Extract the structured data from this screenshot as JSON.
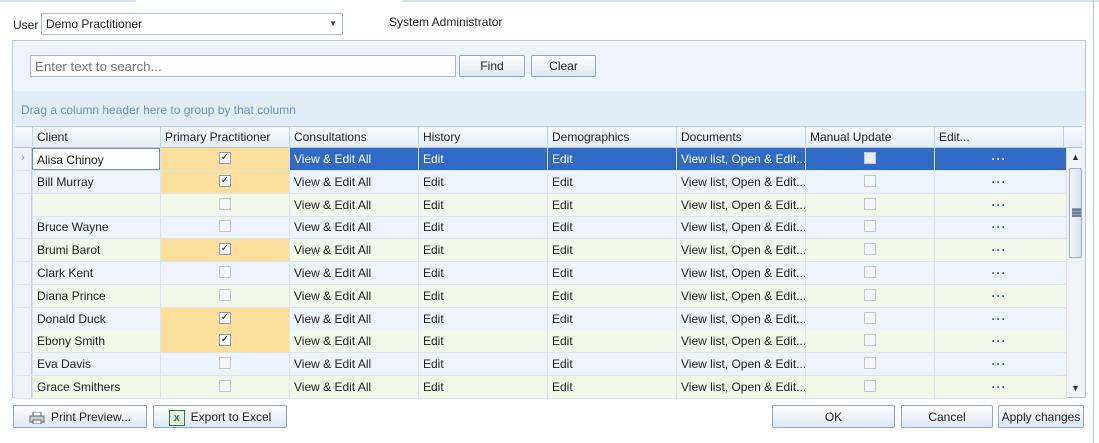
{
  "user": {
    "label": "User",
    "selected": "Demo Practitioner",
    "role": "System Administrator"
  },
  "search": {
    "placeholder": "Enter text to search...",
    "find_label": "Find",
    "clear_label": "Clear"
  },
  "group_hint": "Drag a column header here to group by that column",
  "columns": [
    "Client",
    "Primary Practitioner",
    "Consultations",
    "History",
    "Demographics",
    "Documents",
    "Manual Update",
    "Edit..."
  ],
  "rows": [
    {
      "client": "Alisa Chinoy",
      "primary": true,
      "consultations": "View & Edit All",
      "history": "Edit",
      "demographics": "Edit",
      "documents": "View list, Open & Edit...",
      "manual": false,
      "edit": "···",
      "selected": true
    },
    {
      "client": "Bill Murray",
      "primary": true,
      "consultations": "View & Edit All",
      "history": "Edit",
      "demographics": "Edit",
      "documents": "View list, Open & Edit...",
      "manual": false,
      "edit": "···"
    },
    {
      "client": "",
      "primary": false,
      "consultations": "View & Edit All",
      "history": "Edit",
      "demographics": "Edit",
      "documents": "View list, Open & Edit...",
      "manual": false,
      "edit": "···"
    },
    {
      "client": "Bruce Wayne",
      "primary": false,
      "consultations": "View & Edit All",
      "history": "Edit",
      "demographics": "Edit",
      "documents": "View list, Open & Edit...",
      "manual": false,
      "edit": "···"
    },
    {
      "client": "Brumi Barot",
      "primary": true,
      "consultations": "View & Edit All",
      "history": "Edit",
      "demographics": "Edit",
      "documents": "View list, Open & Edit...",
      "manual": false,
      "edit": "···"
    },
    {
      "client": "Clark Kent",
      "primary": false,
      "consultations": "View & Edit All",
      "history": "Edit",
      "demographics": "Edit",
      "documents": "View list, Open & Edit...",
      "manual": false,
      "edit": "···"
    },
    {
      "client": "Diana Prince",
      "primary": false,
      "consultations": "View & Edit All",
      "history": "Edit",
      "demographics": "Edit",
      "documents": "View list, Open & Edit...",
      "manual": false,
      "edit": "···"
    },
    {
      "client": "Donald Duck",
      "primary": true,
      "consultations": "View & Edit All",
      "history": "Edit",
      "demographics": "Edit",
      "documents": "View list, Open & Edit...",
      "manual": false,
      "edit": "···"
    },
    {
      "client": "Ebony Smith",
      "primary": true,
      "consultations": "View & Edit All",
      "history": "Edit",
      "demographics": "Edit",
      "documents": "View list, Open & Edit...",
      "manual": false,
      "edit": "···"
    },
    {
      "client": "Eva Davis",
      "primary": false,
      "consultations": "View & Edit All",
      "history": "Edit",
      "demographics": "Edit",
      "documents": "View list, Open & Edit...",
      "manual": false,
      "edit": "···"
    },
    {
      "client": "Grace Smithers",
      "primary": false,
      "consultations": "View & Edit All",
      "history": "Edit",
      "demographics": "Edit",
      "documents": "View list, Open & Edit...",
      "manual": false,
      "edit": "···"
    }
  ],
  "footer": {
    "print_preview": "Print Preview...",
    "export_excel": "Export to Excel",
    "ok": "OK",
    "cancel": "Cancel",
    "apply": "Apply changes"
  },
  "colors": {
    "selection": "#316ac5",
    "highlight": "#fddf9c",
    "alt_row": "#f2f8ea",
    "hint_text": "#6d93c2"
  },
  "icons": {
    "print": "printer-icon",
    "excel": "excel-icon",
    "dropdown": "chevron-down-icon"
  }
}
